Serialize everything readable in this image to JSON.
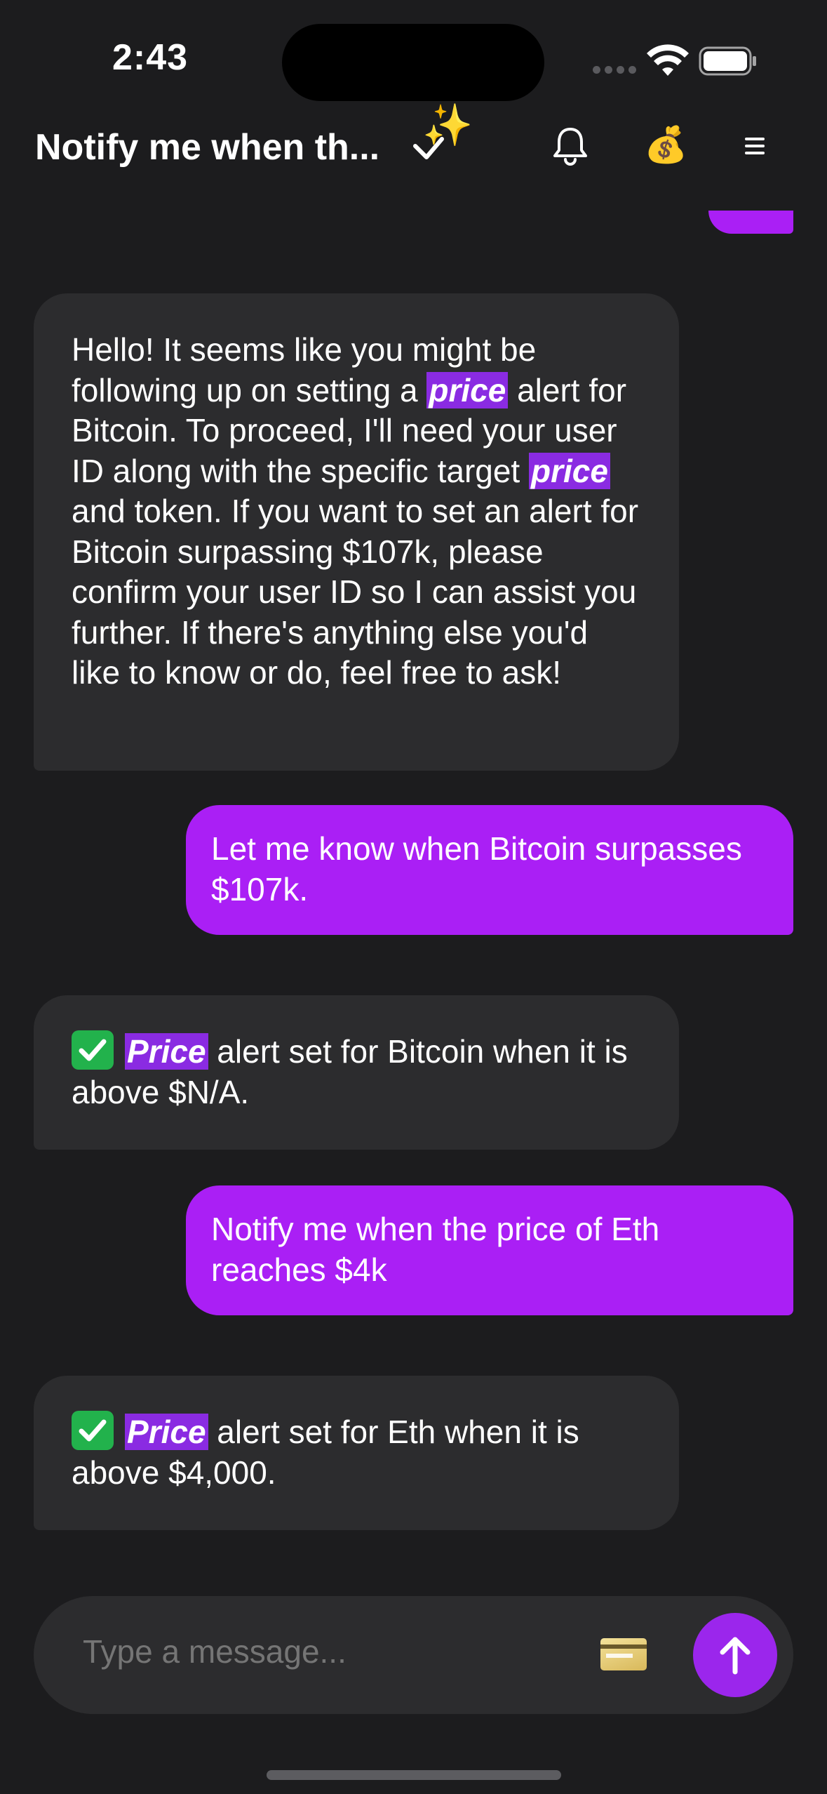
{
  "status_bar": {
    "time": "2:43"
  },
  "header": {
    "title": "Notify me when th...",
    "sparkles_icon": "✨",
    "money_icon": "💰"
  },
  "messages": [
    {
      "role": "assistant",
      "segments": [
        {
          "text": "Hello! It seems like you might be following up on setting a "
        },
        {
          "text": "price",
          "highlight": true
        },
        {
          "text": " alert for Bitcoin. To proceed, I'll need your user ID along with the specific target "
        },
        {
          "text": "price",
          "highlight": true
        },
        {
          "text": " and token. If you want to set an alert for Bitcoin surpassing $107k, please confirm your user ID so I can assist you further. If there's anything else you'd like to know or do, feel free to ask!"
        }
      ]
    },
    {
      "role": "user",
      "text": "Let me know when Bitcoin surpasses $107k."
    },
    {
      "role": "assistant",
      "check": true,
      "segments": [
        {
          "text": "Price",
          "highlight": true
        },
        {
          "text": " alert set for Bitcoin when it is above $N/A."
        }
      ]
    },
    {
      "role": "user",
      "text": "Notify me when the price of Eth reaches $4k"
    },
    {
      "role": "assistant",
      "check": true,
      "segments": [
        {
          "text": "Price",
          "highlight": true
        },
        {
          "text": " alert set for Eth when it is above $4,000."
        }
      ]
    }
  ],
  "composer": {
    "placeholder": "Type a message..."
  },
  "colors": {
    "background": "#1c1c1e",
    "bot_bubble": "#2c2c2e",
    "user_bubble": "#aa1ff5",
    "highlight": "#8a2be2",
    "send_button": "#9b26ec"
  }
}
